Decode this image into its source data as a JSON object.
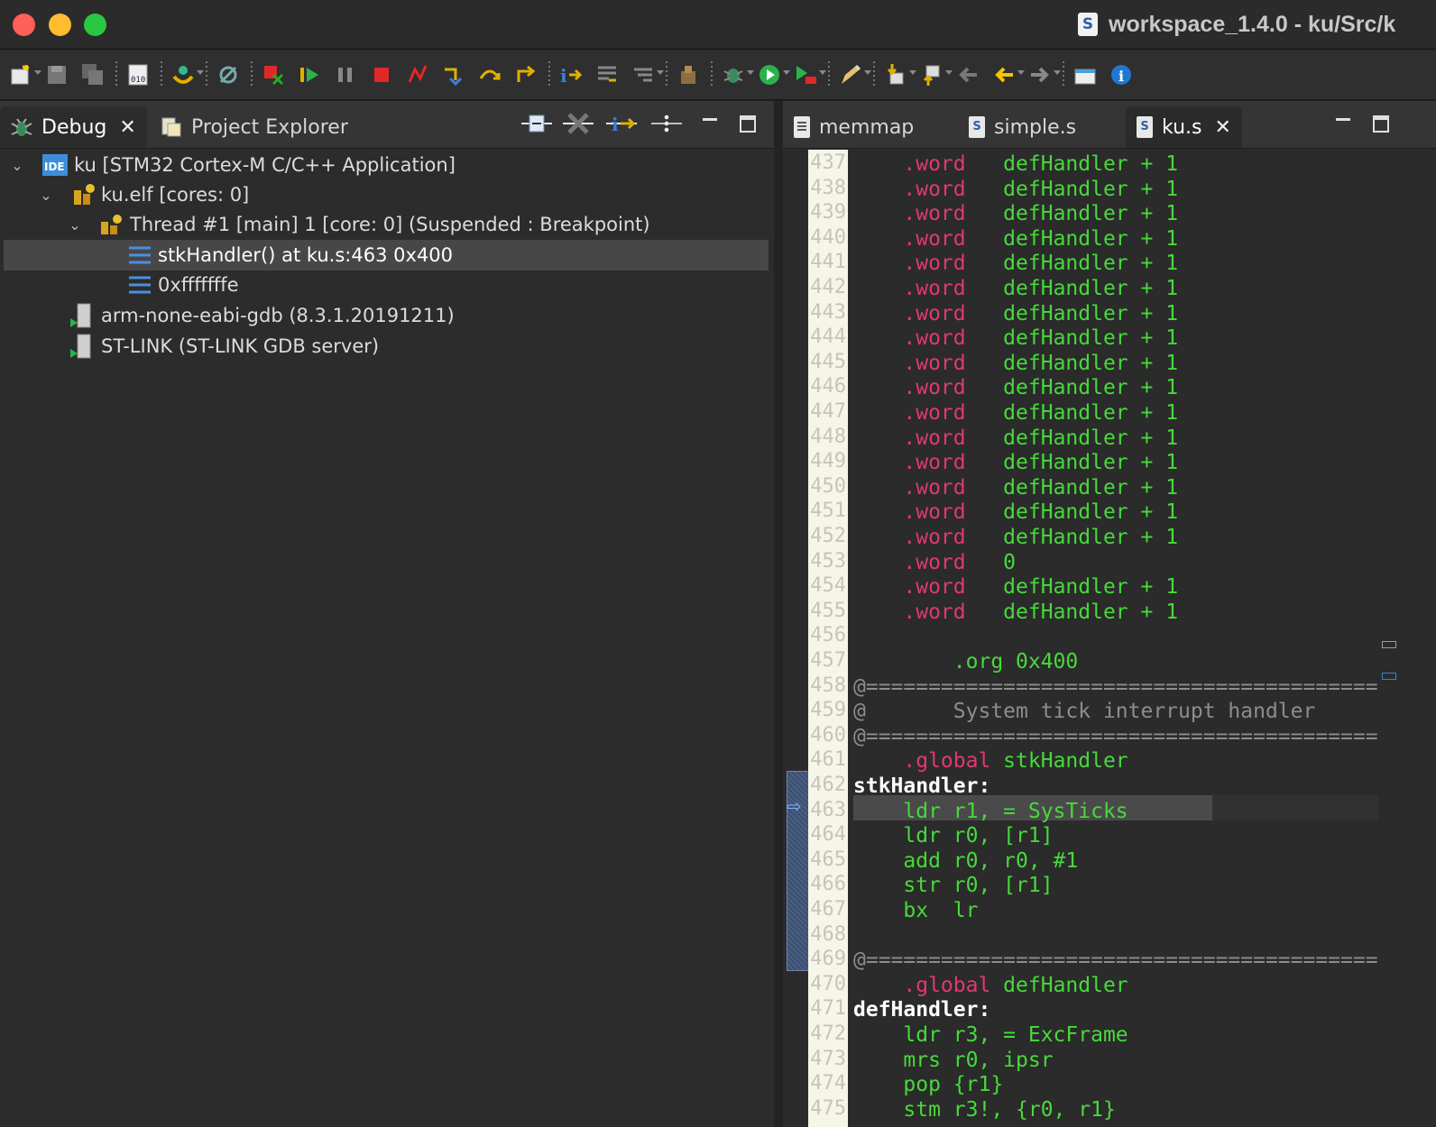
{
  "window": {
    "title": "workspace_1.4.0 - ku/Src/k",
    "title_icon": "S"
  },
  "toolbar": {
    "buttons": [
      "new-icon",
      "save-icon",
      "save-all-icon",
      "binary-icon",
      "debug-config-icon",
      "skip-breakpoints-icon",
      "remove-terminated-icon",
      "resume-icon",
      "suspend-icon",
      "terminate-icon",
      "disconnect-icon",
      "step-into-icon",
      "step-over-icon",
      "step-return-icon",
      "instruction-stepping-icon",
      "use-step-filters-icon",
      "drop-to-frame-icon",
      "build-icon",
      "debug-icon",
      "run-icon",
      "external-tools-icon",
      "edit-icon",
      "next-annotation-icon",
      "previous-annotation-icon",
      "back-icon",
      "forward-icon",
      "open-perspective-icon",
      "info-icon"
    ]
  },
  "debug_view": {
    "tabs": [
      {
        "label": "Debug",
        "active": true
      },
      {
        "label": "Project Explorer",
        "active": false
      }
    ],
    "tree": [
      {
        "label": "ku [STM32 Cortex-M C/C++ Application]",
        "icon": "ide-launch-icon",
        "level": 0,
        "expanded": true
      },
      {
        "label": "ku.elf [cores: 0]",
        "icon": "process-icon",
        "level": 1,
        "expanded": true
      },
      {
        "label": "Thread #1 [main] 1 [core: 0] (Suspended : Breakpoint)",
        "icon": "thread-icon",
        "level": 2,
        "expanded": true
      },
      {
        "label": "stkHandler() at ku.s:463 0x400",
        "icon": "stack-frame-icon",
        "level": 3,
        "selected": true
      },
      {
        "label": "0xfffffffe",
        "icon": "stack-frame-icon",
        "level": 3
      },
      {
        "label": "arm-none-eabi-gdb (8.3.1.20191211)",
        "icon": "debugger-process-icon",
        "level": 1
      },
      {
        "label": "ST-LINK (ST-LINK GDB server)",
        "icon": "debugger-process-icon",
        "level": 1
      }
    ]
  },
  "editor": {
    "tabs": [
      {
        "label": "memmap",
        "icon": "document-icon",
        "active": false
      },
      {
        "label": "simple.s",
        "icon": "asm-file-icon",
        "active": false
      },
      {
        "label": "ku.s",
        "icon": "asm-file-icon",
        "active": true
      }
    ],
    "current_line": 463,
    "lines": [
      {
        "n": "437",
        "parts": [
          [
            "    ",
            ""
          ],
          [
            ".word",
            "kw"
          ],
          [
            "   defHandler + 1",
            "gr"
          ]
        ]
      },
      {
        "n": "438",
        "parts": [
          [
            "    ",
            ""
          ],
          [
            ".word",
            "kw"
          ],
          [
            "   defHandler + 1",
            "gr"
          ]
        ]
      },
      {
        "n": "439",
        "parts": [
          [
            "    ",
            ""
          ],
          [
            ".word",
            "kw"
          ],
          [
            "   defHandler + 1",
            "gr"
          ]
        ]
      },
      {
        "n": "440",
        "parts": [
          [
            "    ",
            ""
          ],
          [
            ".word",
            "kw"
          ],
          [
            "   defHandler + 1",
            "gr"
          ]
        ]
      },
      {
        "n": "441",
        "parts": [
          [
            "    ",
            ""
          ],
          [
            ".word",
            "kw"
          ],
          [
            "   defHandler + 1",
            "gr"
          ]
        ]
      },
      {
        "n": "442",
        "parts": [
          [
            "    ",
            ""
          ],
          [
            ".word",
            "kw"
          ],
          [
            "   defHandler + 1",
            "gr"
          ]
        ]
      },
      {
        "n": "443",
        "parts": [
          [
            "    ",
            ""
          ],
          [
            ".word",
            "kw"
          ],
          [
            "   defHandler + 1",
            "gr"
          ]
        ]
      },
      {
        "n": "444",
        "parts": [
          [
            "    ",
            ""
          ],
          [
            ".word",
            "kw"
          ],
          [
            "   defHandler + 1",
            "gr"
          ]
        ]
      },
      {
        "n": "445",
        "parts": [
          [
            "    ",
            ""
          ],
          [
            ".word",
            "kw"
          ],
          [
            "   defHandler + 1",
            "gr"
          ]
        ]
      },
      {
        "n": "446",
        "parts": [
          [
            "    ",
            ""
          ],
          [
            ".word",
            "kw"
          ],
          [
            "   defHandler + 1",
            "gr"
          ]
        ]
      },
      {
        "n": "447",
        "parts": [
          [
            "    ",
            ""
          ],
          [
            ".word",
            "kw"
          ],
          [
            "   defHandler + 1",
            "gr"
          ]
        ]
      },
      {
        "n": "448",
        "parts": [
          [
            "    ",
            ""
          ],
          [
            ".word",
            "kw"
          ],
          [
            "   defHandler + 1",
            "gr"
          ]
        ]
      },
      {
        "n": "449",
        "parts": [
          [
            "    ",
            ""
          ],
          [
            ".word",
            "kw"
          ],
          [
            "   defHandler + 1",
            "gr"
          ]
        ]
      },
      {
        "n": "450",
        "parts": [
          [
            "    ",
            ""
          ],
          [
            ".word",
            "kw"
          ],
          [
            "   defHandler + 1",
            "gr"
          ]
        ]
      },
      {
        "n": "451",
        "parts": [
          [
            "    ",
            ""
          ],
          [
            ".word",
            "kw"
          ],
          [
            "   defHandler + 1",
            "gr"
          ]
        ]
      },
      {
        "n": "452",
        "parts": [
          [
            "    ",
            ""
          ],
          [
            ".word",
            "kw"
          ],
          [
            "   defHandler + 1",
            "gr"
          ]
        ]
      },
      {
        "n": "453",
        "parts": [
          [
            "    ",
            ""
          ],
          [
            ".word",
            "kw"
          ],
          [
            "   0",
            "gr"
          ]
        ]
      },
      {
        "n": "454",
        "parts": [
          [
            "    ",
            ""
          ],
          [
            ".word",
            "kw"
          ],
          [
            "   defHandler + 1",
            "gr"
          ]
        ]
      },
      {
        "n": "455",
        "parts": [
          [
            "    ",
            ""
          ],
          [
            ".word",
            "kw"
          ],
          [
            "   defHandler + 1",
            "gr"
          ]
        ]
      },
      {
        "n": "456",
        "parts": []
      },
      {
        "n": "457",
        "parts": [
          [
            "        .org 0x400",
            "gr"
          ]
        ]
      },
      {
        "n": "458",
        "parts": [
          [
            "@========================================================",
            "cm"
          ]
        ]
      },
      {
        "n": "459",
        "parts": [
          [
            "@       System tick interrupt handler",
            "cm"
          ]
        ]
      },
      {
        "n": "460",
        "parts": [
          [
            "@========================================================",
            "cm"
          ]
        ]
      },
      {
        "n": "461",
        "parts": [
          [
            "    ",
            ""
          ],
          [
            ".global",
            "kw"
          ],
          [
            " stkHandler",
            "gr"
          ]
        ]
      },
      {
        "n": "462",
        "parts": [
          [
            "stkHandler:",
            "lb"
          ]
        ]
      },
      {
        "n": "463",
        "parts": [
          [
            "    ldr r1, = SysTicks",
            "gr"
          ]
        ]
      },
      {
        "n": "464",
        "parts": [
          [
            "    ldr r0, [r1]",
            "gr"
          ]
        ]
      },
      {
        "n": "465",
        "parts": [
          [
            "    add r0, r0, #1",
            "gr"
          ]
        ]
      },
      {
        "n": "466",
        "parts": [
          [
            "    str r0, [r1]",
            "gr"
          ]
        ]
      },
      {
        "n": "467",
        "parts": [
          [
            "    bx  lr",
            "gr"
          ]
        ]
      },
      {
        "n": "468",
        "parts": []
      },
      {
        "n": "469",
        "parts": [
          [
            "@========================================================",
            "cm"
          ]
        ]
      },
      {
        "n": "470",
        "parts": [
          [
            "    ",
            ""
          ],
          [
            ".global",
            "kw"
          ],
          [
            " defHandler",
            "gr"
          ]
        ]
      },
      {
        "n": "471",
        "parts": [
          [
            "defHandler:",
            "lb"
          ]
        ]
      },
      {
        "n": "472",
        "parts": [
          [
            "    ldr r3, = ExcFrame",
            "gr"
          ]
        ]
      },
      {
        "n": "473",
        "parts": [
          [
            "    mrs r0, ipsr",
            "gr"
          ]
        ]
      },
      {
        "n": "474",
        "parts": [
          [
            "    pop {r1}",
            "gr"
          ]
        ]
      },
      {
        "n": "475",
        "parts": [
          [
            "    stm r3!, {r0, r1}",
            "gr"
          ]
        ]
      }
    ]
  },
  "colors": {
    "keyword": "#e0396f",
    "code": "#47d93b",
    "comment": "#8d8d8d"
  }
}
